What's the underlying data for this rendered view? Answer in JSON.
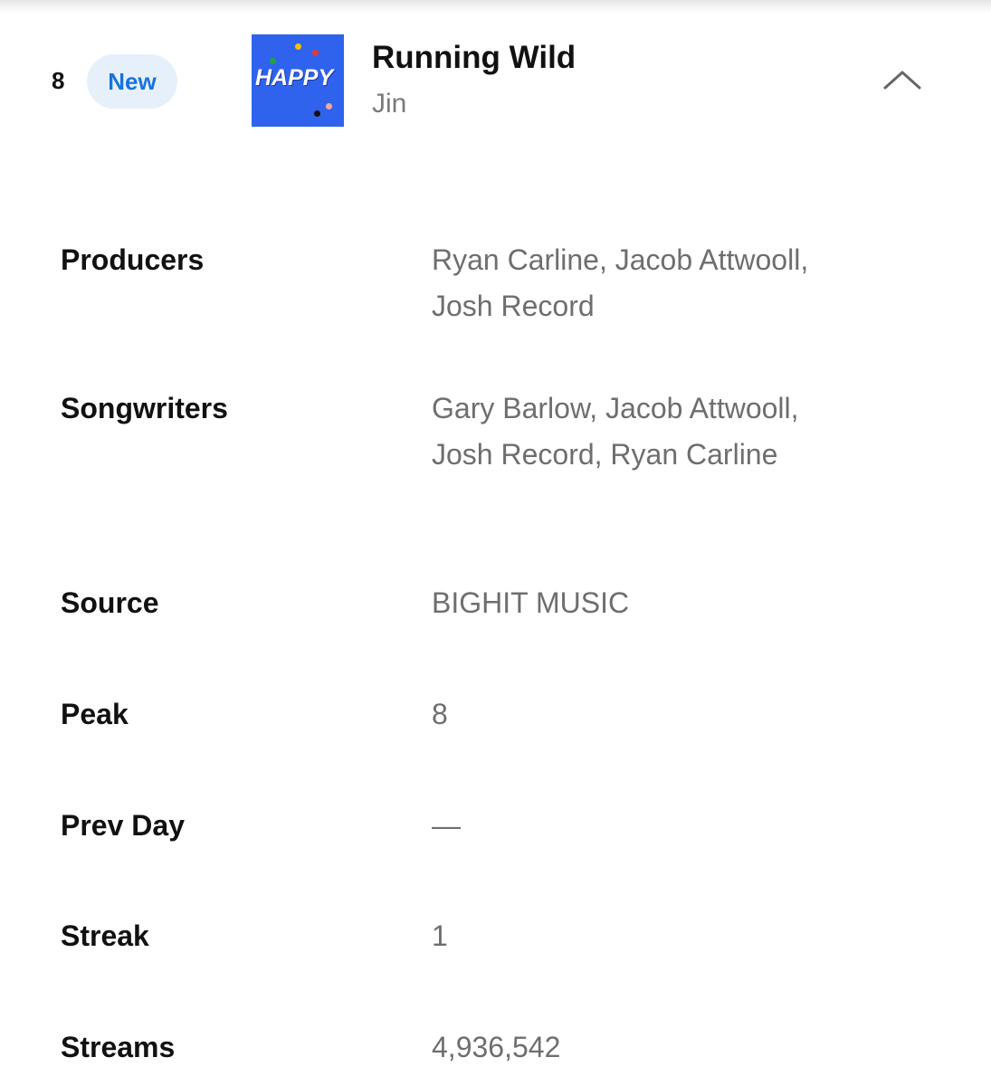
{
  "track": {
    "rank": "8",
    "badge": "New",
    "cover_text": "HAPPY",
    "title": "Running Wild",
    "artist": "Jin"
  },
  "details": {
    "producers": {
      "label": "Producers",
      "value": "Ryan Carline, Jacob Attwooll, Josh Record"
    },
    "songwriters": {
      "label": "Songwriters",
      "value": "Gary Barlow, Jacob Attwooll, Josh Record, Ryan Carline"
    },
    "source": {
      "label": "Source",
      "value": "BIGHIT MUSIC"
    },
    "peak": {
      "label": "Peak",
      "value": "8"
    },
    "prev_day": {
      "label": "Prev Day",
      "value": "—"
    },
    "streak": {
      "label": "Streak",
      "value": "1"
    },
    "streams": {
      "label": "Streams",
      "value": "4,936,542"
    }
  },
  "icons": {
    "collapse": "chevron-up-icon"
  },
  "colors": {
    "badge_bg": "#e6f0fb",
    "badge_text": "#1a73d9",
    "cover_bg": "#2f63ee"
  }
}
